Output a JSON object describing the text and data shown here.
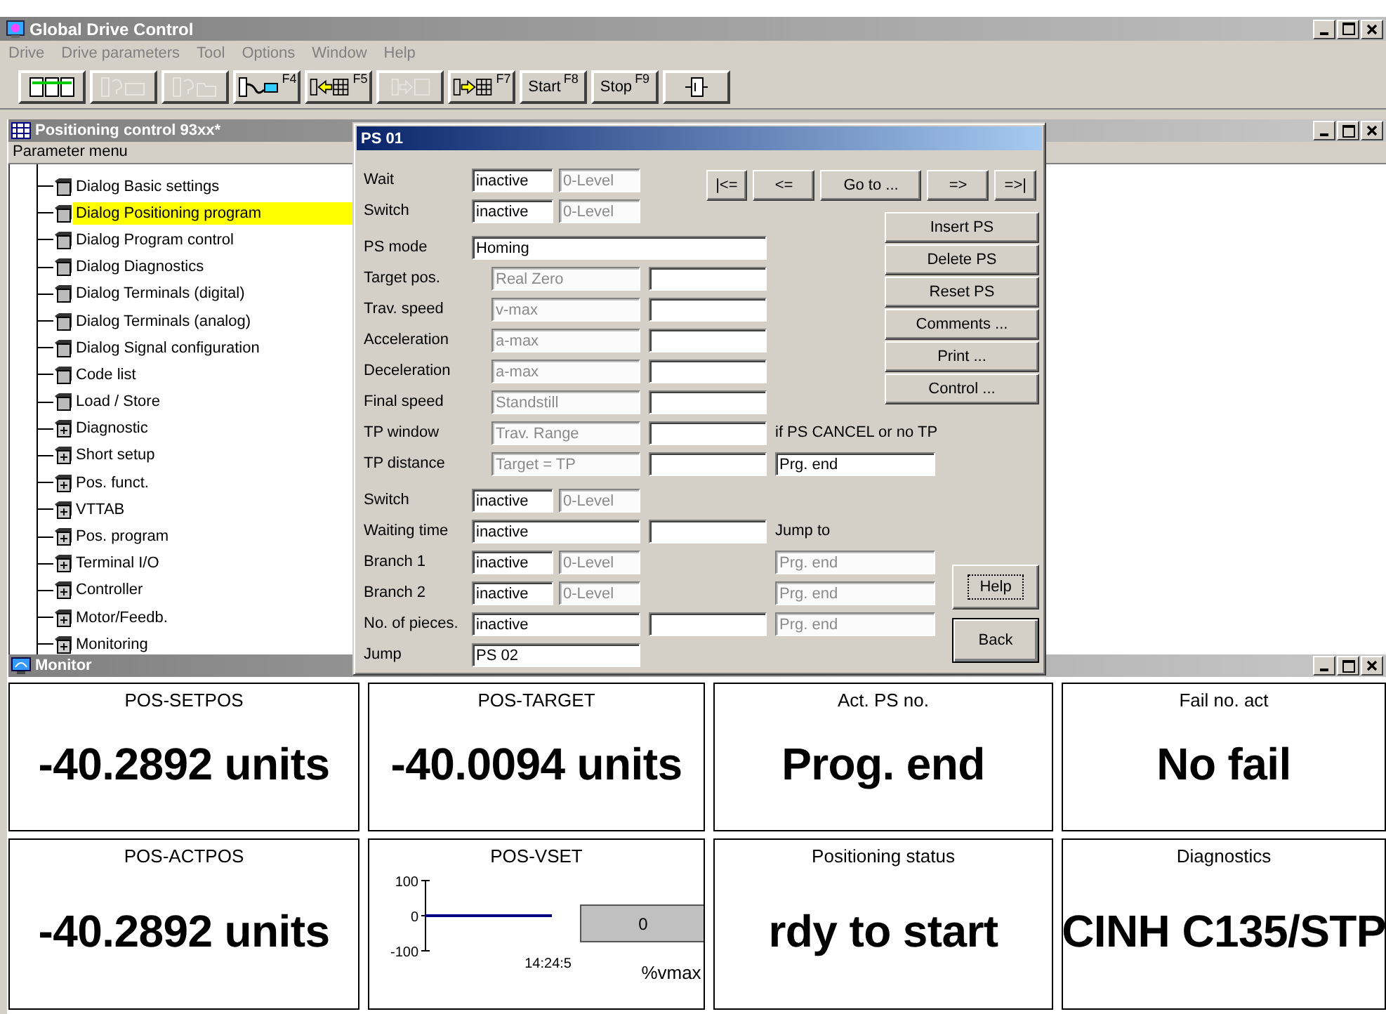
{
  "window": {
    "title": "Global Drive Control"
  },
  "menu": [
    {
      "label": "Drive",
      "disabled": true
    },
    {
      "label": "Drive parameters",
      "disabled": true
    },
    {
      "label": "Tool",
      "disabled": true
    },
    {
      "label": "Options",
      "disabled": true
    },
    {
      "label": "Window",
      "disabled": true
    },
    {
      "label": "Help",
      "disabled": true
    }
  ],
  "toolbar": [
    {
      "kind": "modules",
      "disabled": false
    },
    {
      "kind": "help-window",
      "disabled": true
    },
    {
      "kind": "help-folder",
      "disabled": true
    },
    {
      "kind": "connect",
      "key": "F4",
      "disabled": false
    },
    {
      "kind": "read",
      "key": "F5",
      "disabled": false
    },
    {
      "kind": "transfer",
      "disabled": true
    },
    {
      "kind": "write",
      "key": "F7",
      "disabled": false
    },
    {
      "kind": "text",
      "label": "Start",
      "key": "F8",
      "disabled": false
    },
    {
      "kind": "text",
      "label": "Stop",
      "key": "F9",
      "disabled": false
    },
    {
      "kind": "exit",
      "disabled": false
    }
  ],
  "positioning_window": {
    "title": "Positioning control 93xx*",
    "header": "Parameter menu",
    "items": [
      {
        "label": "Dialog Basic settings",
        "kind": "dialog",
        "selected": false
      },
      {
        "label": "Dialog Positioning program",
        "kind": "dialog",
        "selected": true
      },
      {
        "label": "Dialog Program control",
        "kind": "dialog",
        "selected": false
      },
      {
        "label": "Dialog Diagnostics",
        "kind": "dialog",
        "selected": false
      },
      {
        "label": "Dialog Terminals (digital)",
        "kind": "dialog",
        "selected": false
      },
      {
        "label": "Dialog Terminals (analog)",
        "kind": "dialog",
        "selected": false
      },
      {
        "label": "Dialog Signal configuration",
        "kind": "dialog",
        "selected": false
      },
      {
        "label": "Code list",
        "kind": "dialog",
        "selected": false
      },
      {
        "label": "Load / Store",
        "kind": "dialog",
        "selected": false
      },
      {
        "label": "Diagnostic",
        "kind": "group",
        "selected": false
      },
      {
        "label": "Short setup",
        "kind": "group",
        "selected": false
      },
      {
        "label": "Pos. funct.",
        "kind": "group",
        "selected": false
      },
      {
        "label": "VTTAB",
        "kind": "group",
        "selected": false
      },
      {
        "label": "Pos. program",
        "kind": "group",
        "selected": false
      },
      {
        "label": "Terminal I/O",
        "kind": "group",
        "selected": false
      },
      {
        "label": "Controller",
        "kind": "group",
        "selected": false
      },
      {
        "label": "Motor/Feedb.",
        "kind": "group",
        "selected": false
      },
      {
        "label": "Monitoring",
        "kind": "group",
        "selected": false
      }
    ]
  },
  "dialog": {
    "title": "PS 01",
    "nav": [
      {
        "label": "|<="
      },
      {
        "label": "<="
      },
      {
        "label": "Go to ..."
      },
      {
        "label": "=>"
      },
      {
        "label": "=>|"
      }
    ],
    "sections": [
      [
        {
          "kind": "pair",
          "label": "Wait",
          "fields": [
            {
              "value": "inactive",
              "disabled": false
            },
            {
              "value": "0-Level",
              "disabled": true
            }
          ]
        },
        {
          "kind": "pair",
          "label": "Switch",
          "fields": [
            {
              "value": "inactive",
              "disabled": false
            },
            {
              "value": "0-Level",
              "disabled": true
            }
          ]
        }
      ],
      [
        {
          "kind": "mode",
          "label": "PS mode",
          "fields": [
            {
              "value": "Homing",
              "disabled": false
            }
          ]
        },
        {
          "kind": "param",
          "label": "Target pos.",
          "fields": [
            {
              "value": "Real Zero",
              "disabled": true
            },
            {
              "disabled": false
            }
          ]
        },
        {
          "kind": "param",
          "label": "Trav. speed",
          "fields": [
            {
              "value": "v-max",
              "disabled": true
            },
            {
              "disabled": false
            }
          ]
        },
        {
          "kind": "param",
          "label": "Acceleration",
          "fields": [
            {
              "value": "a-max",
              "disabled": true
            },
            {
              "disabled": false
            }
          ]
        },
        {
          "kind": "param",
          "label": "Deceleration",
          "fields": [
            {
              "value": "a-max",
              "disabled": true
            },
            {
              "disabled": false
            }
          ]
        },
        {
          "kind": "param",
          "label": "Final speed",
          "fields": [
            {
              "value": "Standstill",
              "disabled": true
            },
            {
              "disabled": false
            }
          ]
        },
        {
          "kind": "param",
          "label": "TP window",
          "fields": [
            {
              "value": "Trav. Range",
              "disabled": true
            },
            {
              "disabled": false
            }
          ],
          "extra": {
            "kind": "text",
            "value": "if PS CANCEL or no TP"
          }
        },
        {
          "kind": "param",
          "label": "TP distance",
          "fields": [
            {
              "value": "Target = TP",
              "disabled": true
            },
            {
              "disabled": false
            }
          ],
          "extra": {
            "kind": "field",
            "value": "Prg. end",
            "disabled": false
          }
        }
      ],
      [
        {
          "kind": "pair",
          "label": "Switch",
          "fields": [
            {
              "value": "inactive",
              "disabled": false
            },
            {
              "value": "0-Level",
              "disabled": true
            }
          ]
        },
        {
          "kind": "value",
          "label": "Waiting time",
          "fields": [
            {
              "value": "inactive",
              "disabled": false
            },
            {
              "disabled": false
            }
          ],
          "extra": {
            "kind": "text",
            "value": "Jump to"
          }
        },
        {
          "kind": "pair",
          "label": "Branch 1",
          "fields": [
            {
              "value": "inactive",
              "disabled": false
            },
            {
              "value": "0-Level",
              "disabled": true
            }
          ],
          "extra": {
            "kind": "field",
            "value": "Prg. end",
            "disabled": true
          }
        },
        {
          "kind": "pair",
          "label": "Branch 2",
          "fields": [
            {
              "value": "inactive",
              "disabled": false
            },
            {
              "value": "0-Level",
              "disabled": true
            }
          ],
          "extra": {
            "kind": "field",
            "value": "Prg. end",
            "disabled": true
          }
        },
        {
          "kind": "value",
          "label": "No. of pieces.",
          "fields": [
            {
              "value": "inactive",
              "disabled": false
            },
            {
              "disabled": false
            }
          ],
          "extra": {
            "kind": "field",
            "value": "Prg. end",
            "disabled": true
          }
        },
        {
          "kind": "value",
          "label": "Jump",
          "fields": [
            {
              "value": "PS 02",
              "disabled": false
            }
          ]
        }
      ]
    ],
    "actions": [
      {
        "label": "Insert PS"
      },
      {
        "label": "Delete PS"
      },
      {
        "label": "Reset PS"
      },
      {
        "label": "Comments ..."
      },
      {
        "label": "Print ..."
      },
      {
        "label": "Control ..."
      }
    ],
    "bottom_buttons": [
      {
        "label": "Help",
        "focused": true,
        "default": false
      },
      {
        "label": "Back",
        "focused": false,
        "default": true
      }
    ]
  },
  "monitor": {
    "title": "Monitor",
    "tiles": [
      {
        "kind": "value",
        "title": "POS-SETPOS",
        "value": "-40.2892 units"
      },
      {
        "kind": "value",
        "title": "POS-TARGET",
        "value": "-40.0094 units"
      },
      {
        "kind": "value",
        "title": "Act. PS no.",
        "value": "Prog. end"
      },
      {
        "kind": "value",
        "title": "Fail no. act",
        "value": "No fail"
      },
      {
        "kind": "value",
        "title": "POS-ACTPOS",
        "value": "-40.2892 units"
      },
      {
        "kind": "chart",
        "title": "POS-VSET",
        "reading": "0",
        "unit": "%vmax",
        "time": "14:24:5",
        "axis_labels": [
          "100",
          "0",
          "-100"
        ]
      },
      {
        "kind": "value",
        "title": "Positioning status",
        "value": "rdy to start"
      },
      {
        "kind": "value",
        "title": "Diagnostics",
        "value": "CINH C135/STP"
      }
    ]
  }
}
